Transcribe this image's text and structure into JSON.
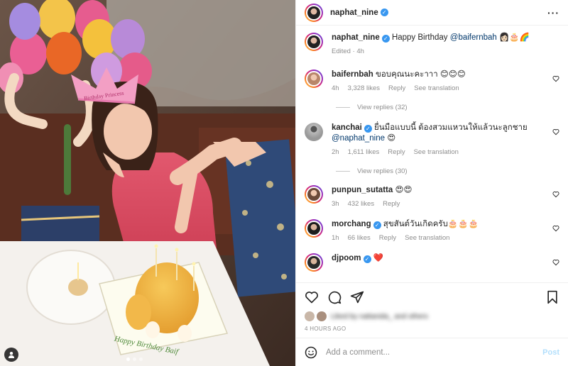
{
  "colors": {
    "link": "#00376b",
    "verified": "#3897f0",
    "muted": "#8e8e8e",
    "post_disabled": "#b2dffc"
  },
  "header": {
    "username": "naphat_nine",
    "verified": true,
    "more_icon": "more-horizontal-icon"
  },
  "caption": {
    "username": "naphat_nine",
    "text": "Happy Birthday",
    "mention": "@baifernbah",
    "emojis": "👩🏻🎂🌈",
    "edited": "Edited",
    "time": "4h"
  },
  "comments": [
    {
      "username": "baifernbah",
      "verified": false,
      "text": "ขอบคุณนะคะาาา 😊😊😊",
      "mention": "",
      "time": "4h",
      "likes": "3,328 likes",
      "reply": "Reply",
      "translate": "See translation",
      "view_replies": "View replies (32)"
    },
    {
      "username": "kanchai",
      "verified": true,
      "text": "ยื่นมือแบบนี้ ต้องสวมแหวนให้แล้วนะลูกชาย",
      "mention": "@naphat_nine",
      "emoji_after": "😍",
      "time": "2h",
      "likes": "1,611 likes",
      "reply": "Reply",
      "translate": "See translation",
      "view_replies": "View replies (30)"
    },
    {
      "username": "punpun_sutatta",
      "verified": false,
      "text": "😍😍",
      "mention": "",
      "time": "3h",
      "likes": "432 likes",
      "reply": "Reply",
      "translate": "",
      "view_replies": ""
    },
    {
      "username": "morchang",
      "verified": true,
      "text": "สุขสันต์วันเกิดครับ🎂🎂🎂",
      "mention": "",
      "time": "1h",
      "likes": "66 likes",
      "reply": "Reply",
      "translate": "See translation",
      "view_replies": ""
    },
    {
      "username": "djpoom",
      "verified": true,
      "text": "❤️",
      "mention": "",
      "time": "",
      "likes": "",
      "reply": "",
      "translate": "",
      "view_replies": ""
    }
  ],
  "photo": {
    "crown_text": "Birthday Princess",
    "cake_text": "Happy Birthday Baif"
  },
  "actions": {
    "like_icon": "heart-icon",
    "comment_icon": "comment-icon",
    "share_icon": "send-icon",
    "save_icon": "bookmark-icon",
    "liked_by_blurred": "Liked by nattanida_ and others",
    "timestamp": "4 HOURS AGO"
  },
  "add_comment": {
    "emoji_icon": "emoji-icon",
    "placeholder": "Add a comment...",
    "post_label": "Post"
  }
}
